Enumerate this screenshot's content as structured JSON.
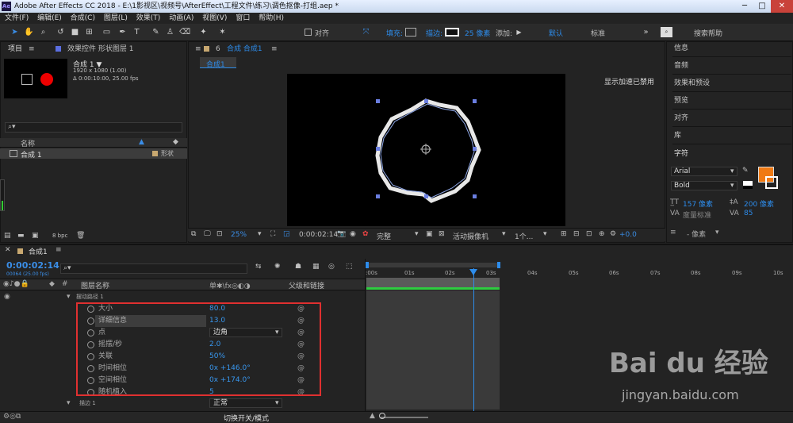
{
  "window": {
    "title": "Adobe After Effects CC 2018 - E:\\1影视区\\视频号\\AfterEffect\\工程文件\\练习\\调色抠像-打组.aep *"
  },
  "menu": [
    "文件(F)",
    "编辑(E)",
    "合成(C)",
    "图层(L)",
    "效果(T)",
    "动画(A)",
    "视图(V)",
    "窗口",
    "帮助(H)"
  ],
  "toolbar": {
    "align_label": "对齐",
    "fill_label": "填充:",
    "stroke_label": "描边:",
    "stroke_width": "25 像素",
    "add_label": "添加:",
    "workspace_default": "默认",
    "workspace_standard": "标准",
    "search_placeholder": "搜索帮助"
  },
  "project_panel": {
    "tab_project": "项目",
    "tab_effects": "效果控件 形状图层 1",
    "comp_name": "合成 1 ▼",
    "comp_size": "1920 x 1080 (1.00)",
    "comp_duration": "Δ 0:00:10:00, 25.00 fps",
    "col_name": "名称",
    "item_name": "合成 1",
    "item_type": "形状",
    "bpc": "8 bpc"
  },
  "comp_panel": {
    "tab": "合成 合成1",
    "breadcrumb": "合成1",
    "gpu_notice": "显示加速已禁用",
    "zoom": "25%",
    "time": "0:00:02:14",
    "quality": "完整",
    "camera": "活动摄像机",
    "views": "1个...",
    "exposure": "+0.0"
  },
  "right_panel": {
    "items": [
      "信息",
      "音频",
      "效果和预设",
      "预览",
      "对齐",
      "库"
    ],
    "char_title": "字符",
    "font": "Arial",
    "style": "Bold",
    "size": "157 像素",
    "leading": "200 像素",
    "tracking_label": "度量标准",
    "tracking_val": "85",
    "unit": "- 像素"
  },
  "timeline": {
    "tab": "合成1",
    "current_time": "0:00:02:14",
    "frames": "00064 (25.00 fps)",
    "col_layer": "图层名称",
    "col_switches": "单✱\\fx◎◐◑",
    "col_parent": "父级和链接",
    "group_name": "摆动路径 1",
    "properties": [
      {
        "name": "大小",
        "value": "80.0"
      },
      {
        "name": "详细信息",
        "value": "13.0"
      },
      {
        "name": "点",
        "value": "边角"
      },
      {
        "name": "摇摆/秒",
        "value": "2.0"
      },
      {
        "name": "关联",
        "value": "50%"
      },
      {
        "name": "时间相位",
        "value": "0x +146.0°"
      },
      {
        "name": "空间相位",
        "value": "0x +174.0°"
      },
      {
        "name": "随机植入",
        "value": "5"
      }
    ],
    "stroke_row": "描边 1",
    "stroke_mode": "正常",
    "footer": "切换开关/模式",
    "ticks": [
      ":00s",
      "01s",
      "02s",
      "03s",
      "04s",
      "05s",
      "06s",
      "07s",
      "08s",
      "09s",
      "10s"
    ]
  },
  "watermark": {
    "brand": "Bai du 经验",
    "url": "jingyan.baidu.com"
  },
  "colors": {
    "accent": "#2d8ceb",
    "fill_swatch": "#f07a14",
    "highlight_box": "#e03030",
    "worktrack": "#2ecc40"
  }
}
